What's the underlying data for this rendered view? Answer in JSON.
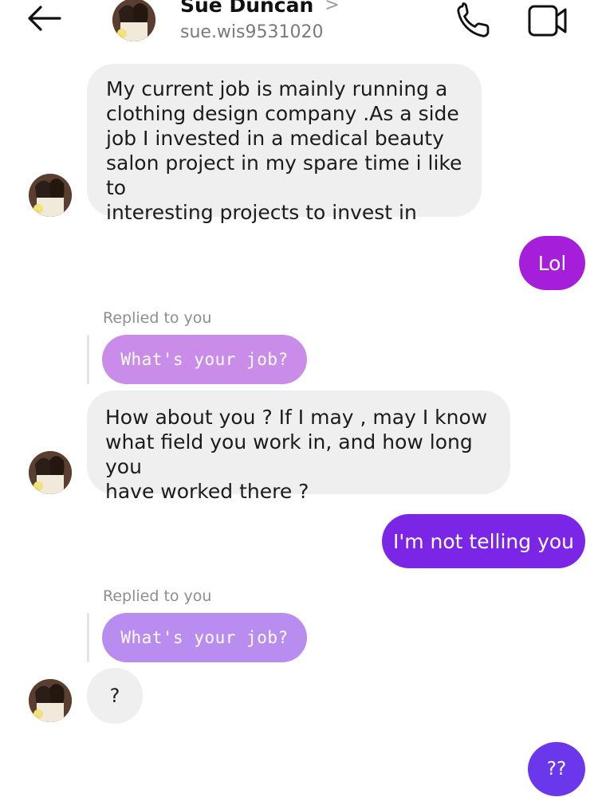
{
  "header": {
    "name": "Sue Duncan",
    "chevron": ">",
    "username": "sue.wis9531020"
  },
  "icons": {
    "back": "arrow-left-icon",
    "call": "phone-icon",
    "video": "video-camera-icon"
  },
  "messages": [
    {
      "from": "them",
      "text": "My current job is mainly running a clothing design company .As a side job I invested in a medical beauty salon project in my spare time i like to interesting projects to invest in",
      "lines": [
        "My current job is mainly running a",
        "clothing design company .As a side",
        "job I invested in a medical beauty",
        "salon project in my spare time i like to",
        "interesting projects to invest in"
      ]
    },
    {
      "from": "me",
      "text": "Lol"
    },
    {
      "from": "them",
      "reply_label": "Replied to you",
      "quoted": "What's your job?",
      "text": "How about you ? If I may , may I know what field you work in, and how long you have worked there  ?",
      "lines": [
        "How about you ? If I may , may I know",
        "what field you work in, and how long you",
        "have worked there  ?"
      ]
    },
    {
      "from": "me",
      "text": "I'm not telling you"
    },
    {
      "from": "them",
      "reply_label": "Replied to you",
      "quoted": "What's your job?",
      "text": "?"
    },
    {
      "from": "me",
      "text": "??"
    }
  ],
  "colors": {
    "incoming_bubble": "#efefef",
    "outgoing_1": "#a51ed9",
    "outgoing_2": "#7b26e6",
    "outgoing_3": "#6a38ea",
    "quoted_bubble": "#c98ce8"
  }
}
